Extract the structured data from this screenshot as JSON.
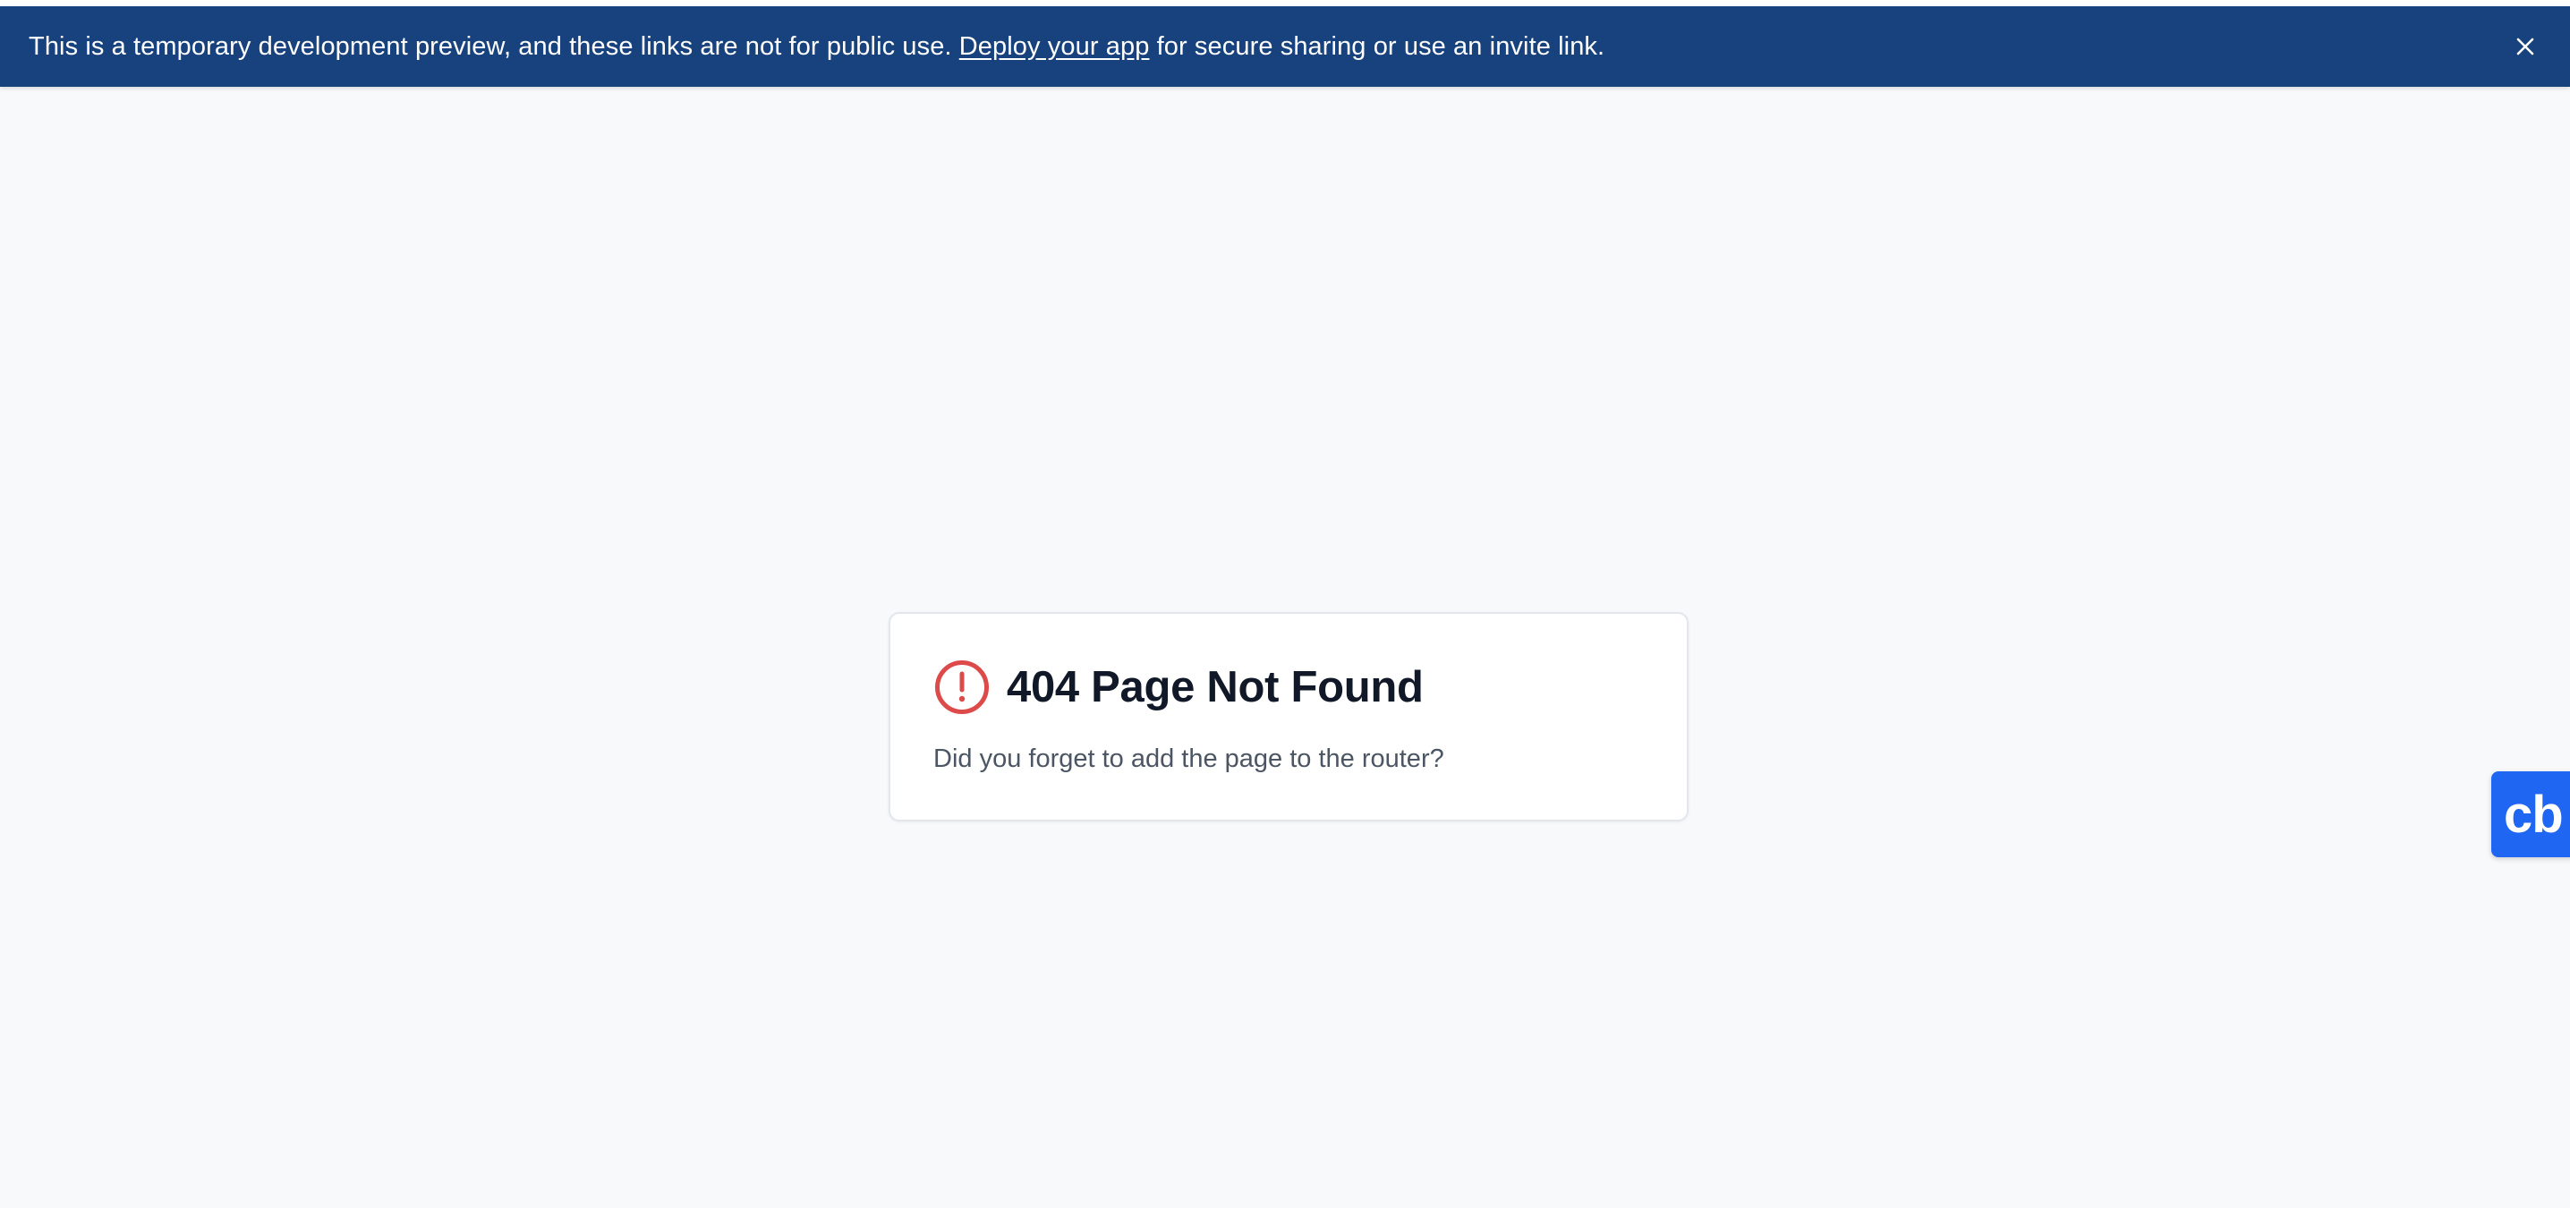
{
  "banner": {
    "text_before": "This is a temporary development preview, and these links are not for public use.",
    "link_label": "Deploy your app",
    "text_after": "for secure sharing or use an invite link.",
    "close_icon": "close-icon"
  },
  "error_card": {
    "icon": "alert-circle-icon",
    "title": "404 Page Not Found",
    "message": "Did you forget to add the page to the router?"
  },
  "widget": {
    "label": "cb"
  },
  "colors": {
    "banner_bg": "#17427d",
    "page_bg": "#f8f9fb",
    "alert_red": "#dc4a4a",
    "widget_blue": "#1f66f2"
  }
}
